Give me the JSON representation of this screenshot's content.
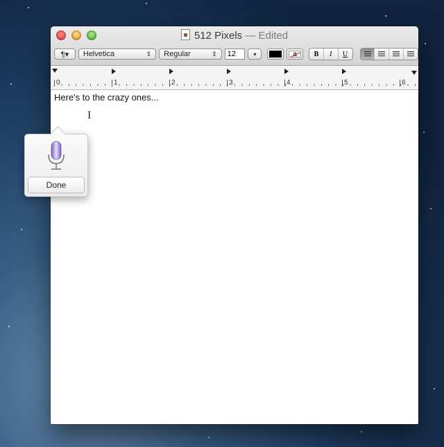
{
  "window": {
    "title": "512 Pixels",
    "title_suffix": "— Edited"
  },
  "toolbar": {
    "paragraph_label": "¶▾",
    "font_family": "Helvetica",
    "font_style": "Regular",
    "font_size": "12",
    "size_menu_arrow": "▾",
    "highlight_glyph": "a",
    "bold_label": "B",
    "italic_label": "I",
    "underline_label": "U",
    "text_color": "#000000"
  },
  "ruler": {
    "numbers": [
      "0",
      "1",
      "2",
      "3",
      "4",
      "5",
      "6"
    ]
  },
  "document": {
    "text": "Here's to the crazy ones..."
  },
  "dictation": {
    "done_label": "Done"
  },
  "colors": {
    "close": "#e0443e",
    "minimize": "#e8a228",
    "zoom": "#5cb83a"
  }
}
